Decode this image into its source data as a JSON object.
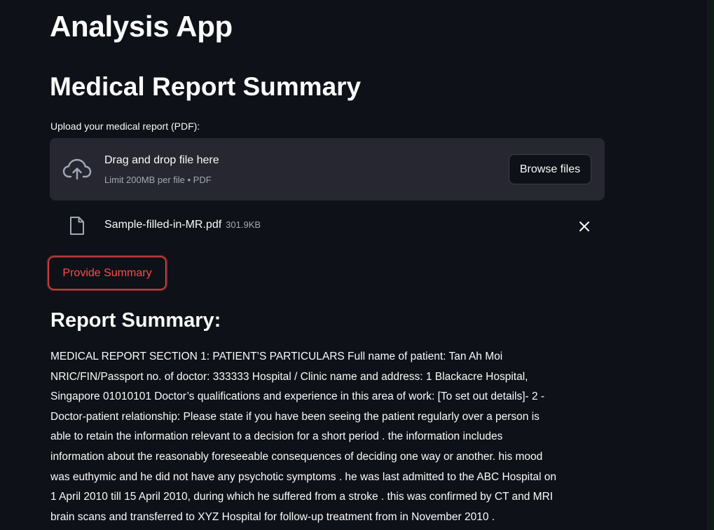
{
  "app": {
    "title": "Analysis App"
  },
  "section": {
    "title": "Medical Report Summary"
  },
  "uploader": {
    "label": "Upload your medical report (PDF):",
    "dropzone_title": "Drag and drop file here",
    "dropzone_subtitle": "Limit 200MB per file • PDF",
    "browse_label": "Browse files",
    "upload_icon": "cloud-upload-icon"
  },
  "uploaded_file": {
    "name": "Sample-filled-in-MR.pdf",
    "size": "301.9KB",
    "file_icon": "file-icon",
    "remove_icon": "close-icon"
  },
  "actions": {
    "summary_label": "Provide Summary"
  },
  "report": {
    "heading": "Report Summary:",
    "lines": [
      "MEDICAL REPORT SECTION 1: PATIENT’S PARTICULARS Full name of patient: Tan Ah Moi",
      "NRIC/FIN/Passport no. of doctor: 333333 Hospital / Clinic name and address: 1 Blackacre Hospital,",
      "Singapore 01010101 Doctor’s qualifications and experience in this area of work: [To set out details]- 2 -",
      "Doctor-patient relationship: Please state if you have been seeing the patient regularly over a person is",
      "able to retain the information relevant to a decision for a short period . the information includes",
      "information about the reasonably foreseeable consequences of deciding one way or another. his mood",
      "was euthymic and he did not have any psychotic symptoms . he was last admitted to the ABC Hospital on",
      "1 April 2010 till 15 April 2010, during which he suffered from a stroke . this was confirmed by CT and MRI",
      "brain scans and transferred to XYZ Hospital for follow-up treatment from in November 2010 ."
    ]
  },
  "theme": {
    "background": "#0e1117",
    "dropzone": "#262730",
    "accent": "#ff4b4b",
    "muted_text": "#a3a8b8"
  }
}
